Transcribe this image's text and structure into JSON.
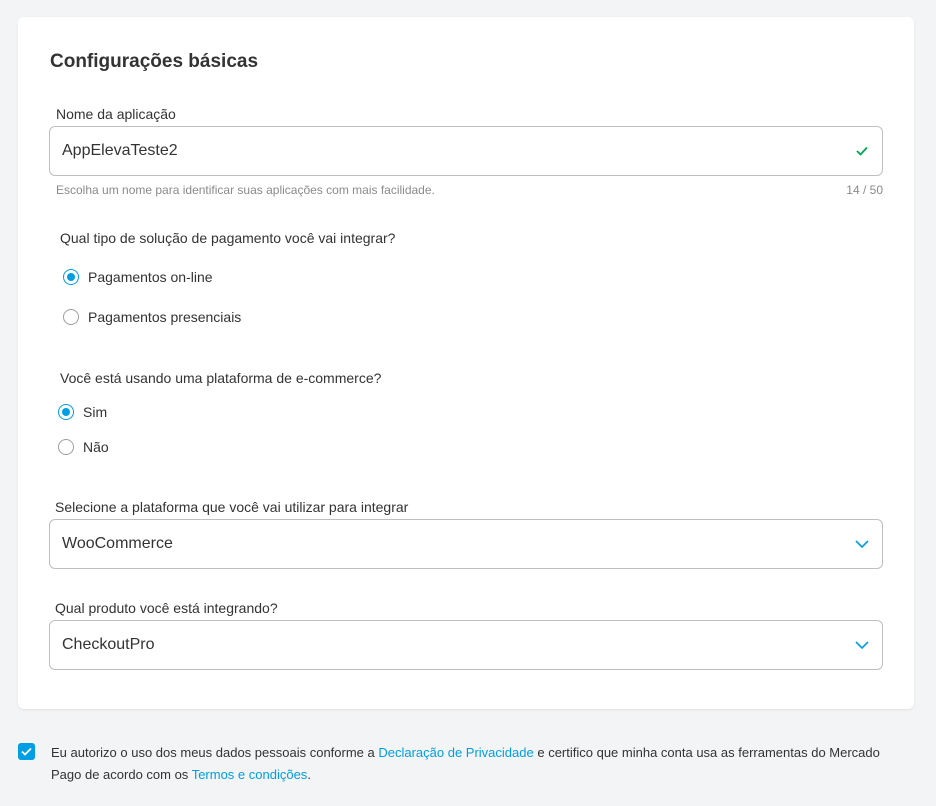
{
  "card": {
    "title": "Configurações básicas"
  },
  "app_name": {
    "label": "Nome da aplicação",
    "value": "AppElevaTeste2",
    "helper": "Escolha um nome para identificar suas aplicações com mais facilidade.",
    "counter": "14 / 50"
  },
  "payment_type": {
    "question": "Qual tipo de solução de pagamento você vai integrar?",
    "options": [
      {
        "label": "Pagamentos on-line",
        "selected": true
      },
      {
        "label": "Pagamentos presenciais",
        "selected": false
      }
    ]
  },
  "ecommerce": {
    "question": "Você está usando uma plataforma de e-commerce?",
    "options": [
      {
        "label": "Sim",
        "selected": true
      },
      {
        "label": "Não",
        "selected": false
      }
    ]
  },
  "platform": {
    "label": "Selecione a plataforma que você vai utilizar para integrar",
    "value": "WooCommerce"
  },
  "product": {
    "label": "Qual produto você está integrando?",
    "value": "CheckoutPro"
  },
  "consent": {
    "checked": true,
    "text_1": "Eu autorizo o uso dos meus dados pessoais conforme a ",
    "privacy_link": "Declaração de Privacidade",
    "text_2": " e certifico que minha conta usa as ferramentas do Mercado Pago de acordo com os ",
    "terms_link": "Termos e condições",
    "text_3": "."
  },
  "colors": {
    "accent": "#009ee3",
    "valid": "#00a650"
  },
  "icons": {
    "valid": "check-icon",
    "dropdown": "chevron-down-icon",
    "consent": "checkbox-checked-icon"
  }
}
